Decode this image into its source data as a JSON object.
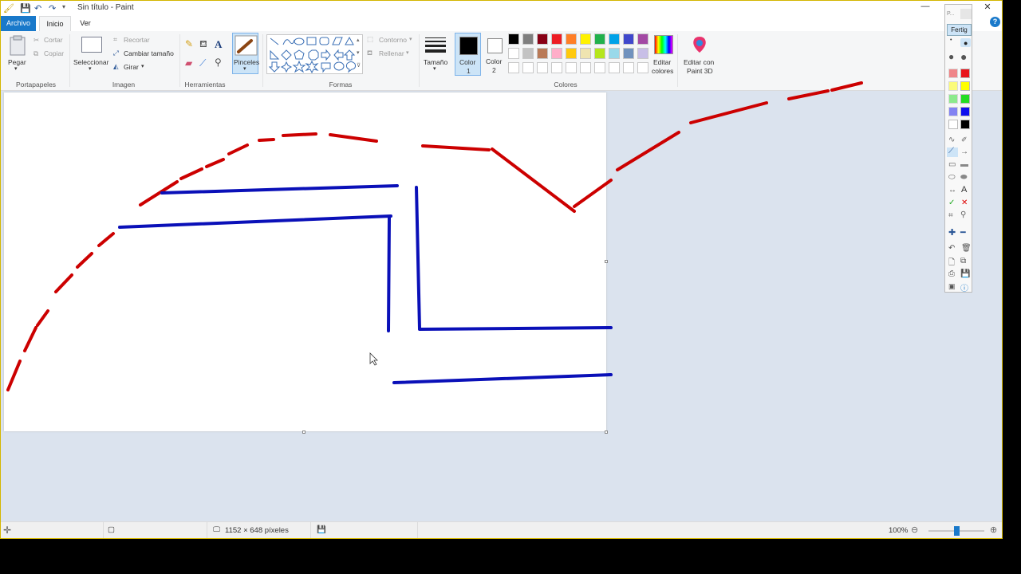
{
  "window": {
    "title": "Sin título - Paint",
    "minimize": "—",
    "close": "✕"
  },
  "tabs": {
    "archivo": "Archivo",
    "inicio": "Inicio",
    "ver": "Ver",
    "help": "?"
  },
  "ribbon": {
    "clipboard": {
      "paste": "Pegar",
      "cut": "Cortar",
      "copy": "Copiar",
      "group": "Portapapeles"
    },
    "image": {
      "select": "Seleccionar",
      "crop": "Recortar",
      "resize": "Cambiar tamaño",
      "rotate": "Girar",
      "group": "Imagen"
    },
    "tools": {
      "group": "Herramientas",
      "text_glyph": "A"
    },
    "brushes": {
      "label": "Pinceles"
    },
    "shapes": {
      "outline": "Contorno",
      "fill": "Rellenar",
      "group": "Formas"
    },
    "size": {
      "label": "Tamaño"
    },
    "color1": {
      "label1": "Color",
      "label2": "1"
    },
    "color2": {
      "label1": "Color",
      "label2": "2"
    },
    "colors": {
      "group": "Colores",
      "edit1": "Editar",
      "edit2": "colores"
    },
    "paint3d": {
      "line1": "Editar con",
      "line2": "Paint 3D"
    }
  },
  "palette": {
    "row1": [
      "#000000",
      "#7f7f7f",
      "#880015",
      "#ed1c24",
      "#ff7f27",
      "#fff200",
      "#22b14c",
      "#00a2e8",
      "#3f48cc",
      "#a349a4"
    ],
    "row2": [
      "#ffffff",
      "#c3c3c3",
      "#b97a57",
      "#ffaec9",
      "#ffc90e",
      "#efe4b0",
      "#b5e61d",
      "#99d9ea",
      "#7092be",
      "#c8bfe7"
    ],
    "row3": [
      "#ffffff",
      "#ffffff",
      "#ffffff",
      "#ffffff",
      "#ffffff",
      "#ffffff",
      "#ffffff",
      "#ffffff",
      "#ffffff",
      "#ffffff"
    ],
    "color1_value": "#000000",
    "color2_value": "#ffffff"
  },
  "drawing": {
    "red": "#cc0000",
    "blue": "#0a10b8"
  },
  "floating_toolbar": {
    "title": "P...",
    "done": "Fertig",
    "red": "#e8141b",
    "yellow": "#ffff00",
    "green": "#22dd22",
    "blue": "#1010ee",
    "white": "#ffffff",
    "black": "#000000"
  },
  "status": {
    "dimensions": "1152 × 648 píxeles",
    "zoom": "100%",
    "zoom_level": 0.5
  }
}
